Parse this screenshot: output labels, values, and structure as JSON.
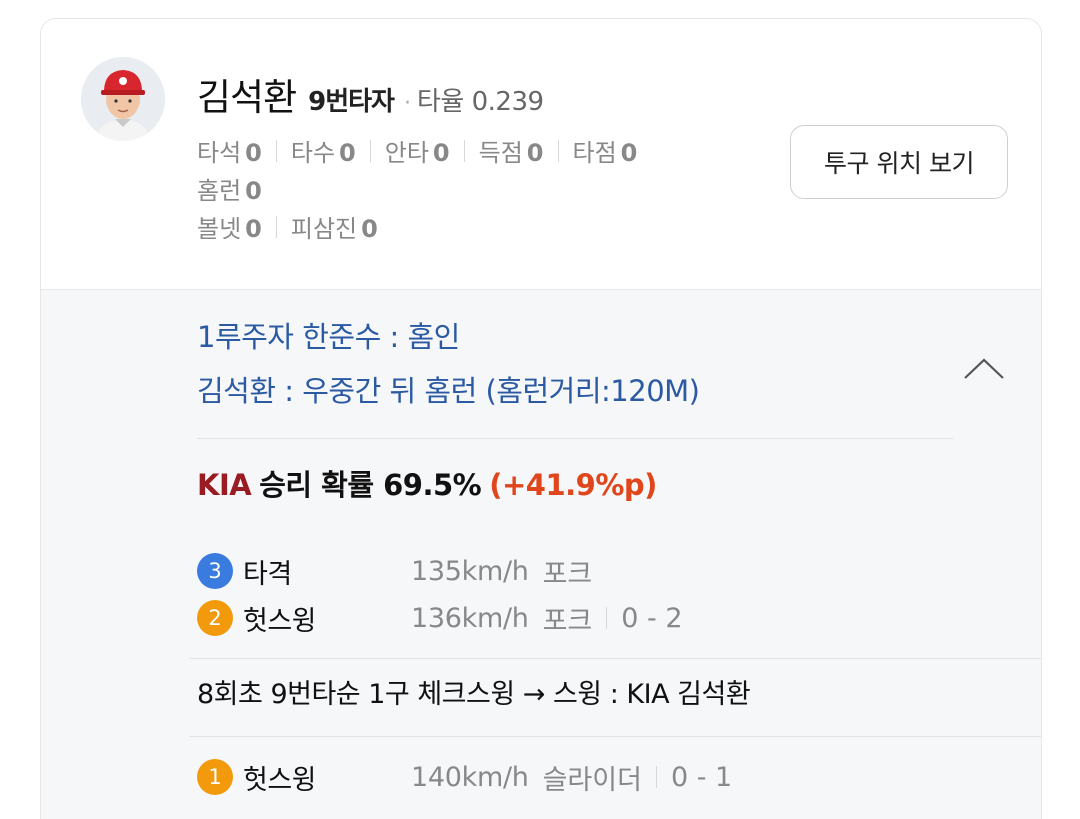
{
  "player": {
    "name": "김석환",
    "batting_order": "9번타자",
    "avg_label": "타율",
    "avg_value": "0.239"
  },
  "stats": [
    {
      "label": "타석",
      "value": "0"
    },
    {
      "label": "타수",
      "value": "0"
    },
    {
      "label": "안타",
      "value": "0"
    },
    {
      "label": "득점",
      "value": "0"
    },
    {
      "label": "타점",
      "value": "0"
    },
    {
      "label": "홈런",
      "value": "0"
    },
    {
      "label": "볼넷",
      "value": "0"
    },
    {
      "label": "피삼진",
      "value": "0"
    }
  ],
  "pitch_location_button": "투구 위치 보기",
  "play_summary": [
    "1루주자 한준수 : 홈인",
    "김석환 : 우중간 뒤 홈런 (홈런거리:120M)"
  ],
  "win_probability": {
    "team": "KIA",
    "text": "승리 확률 69.5%",
    "delta": "(+41.9%p)"
  },
  "pitches_top": [
    {
      "num": "3",
      "color": "#3a7be0",
      "result": "타격",
      "speed": "135km/h",
      "type": "포크",
      "count": ""
    },
    {
      "num": "2",
      "color": "#f29a0c",
      "result": "헛스윙",
      "speed": "136km/h",
      "type": "포크",
      "count": "0 - 2"
    }
  ],
  "event_text": "8회초 9번타순 1구 체크스윙 → 스윙 : KIA 김석환",
  "pitches_bottom": [
    {
      "num": "1",
      "color": "#f29a0c",
      "result": "헛스윙",
      "speed": "140km/h",
      "type": "슬라이더",
      "count": "0 - 1"
    }
  ]
}
